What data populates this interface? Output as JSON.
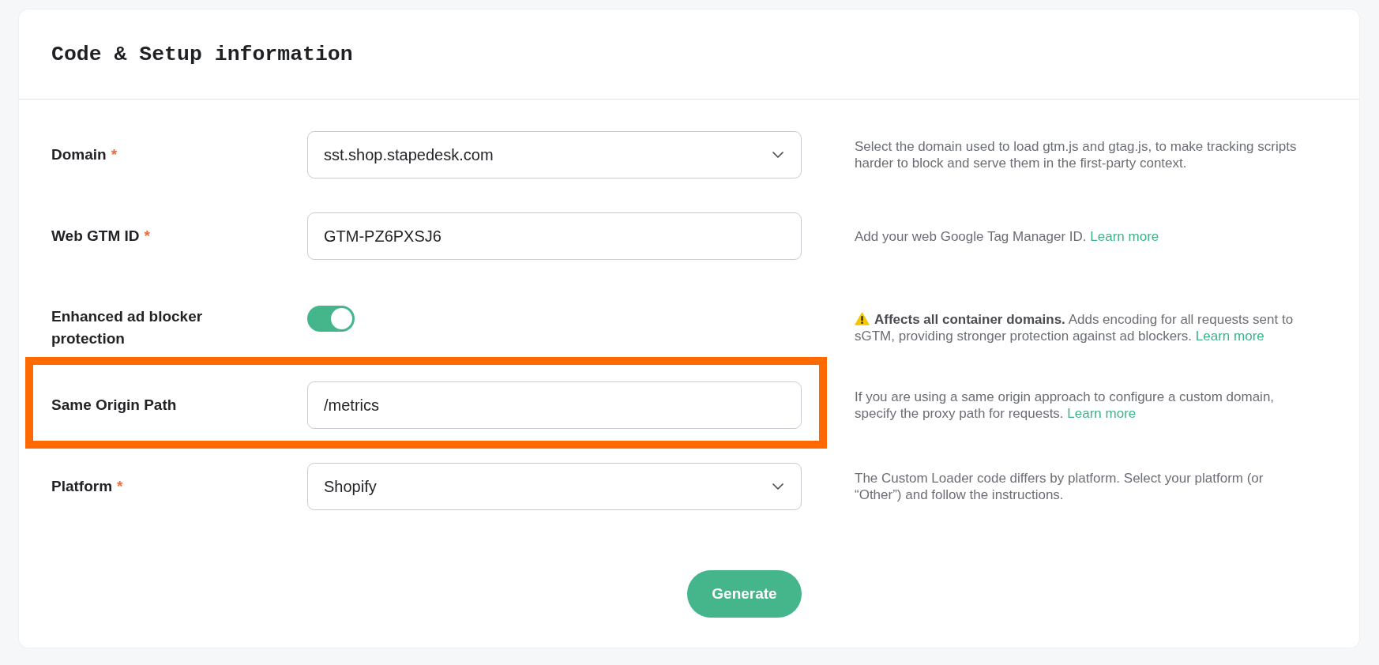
{
  "card": {
    "title": "Code & Setup information"
  },
  "fields": [
    {
      "kind": "select",
      "label": "Domain",
      "required_mark": "*",
      "value": "sst.shop.stapedesk.com",
      "highlighted": false,
      "hint": {
        "kind": "note",
        "text": "Select the domain used to load gtm.js and gtag.js, to make tracking scripts harder to block and serve them in the first-party context."
      }
    },
    {
      "kind": "text",
      "label": "Web GTM ID",
      "required_mark": "*",
      "value": "GTM-PZ6PXSJ6",
      "highlighted": false,
      "hint": {
        "kind": "note",
        "text": "Add your web Google Tag Manager ID.",
        "link": "Learn more"
      }
    },
    {
      "kind": "toggle",
      "label": "Enhanced ad blocker protection",
      "on": true,
      "highlighted": false,
      "hint": {
        "kind": "warning",
        "text": "**Affects all container domains.** Adds encoding for all requests sent to sGTM, providing stronger protection against ad blockers.",
        "link": "Learn more"
      }
    },
    {
      "kind": "text",
      "label": "Same Origin Path",
      "value": "/metrics",
      "highlighted": true,
      "hint": {
        "kind": "note",
        "text": "If you are using a same origin approach to configure a custom domain, specify the proxy path for requests.",
        "link": "Learn more"
      }
    },
    {
      "kind": "select",
      "label": "Platform",
      "required_mark": "*",
      "value": "Shopify",
      "highlighted": false,
      "hint": {
        "kind": "note",
        "text": "The Custom Loader code differs by platform. Select your platform (or “Other”) and follow the instructions."
      }
    }
  ],
  "submit_button": {
    "label": "Generate"
  }
}
